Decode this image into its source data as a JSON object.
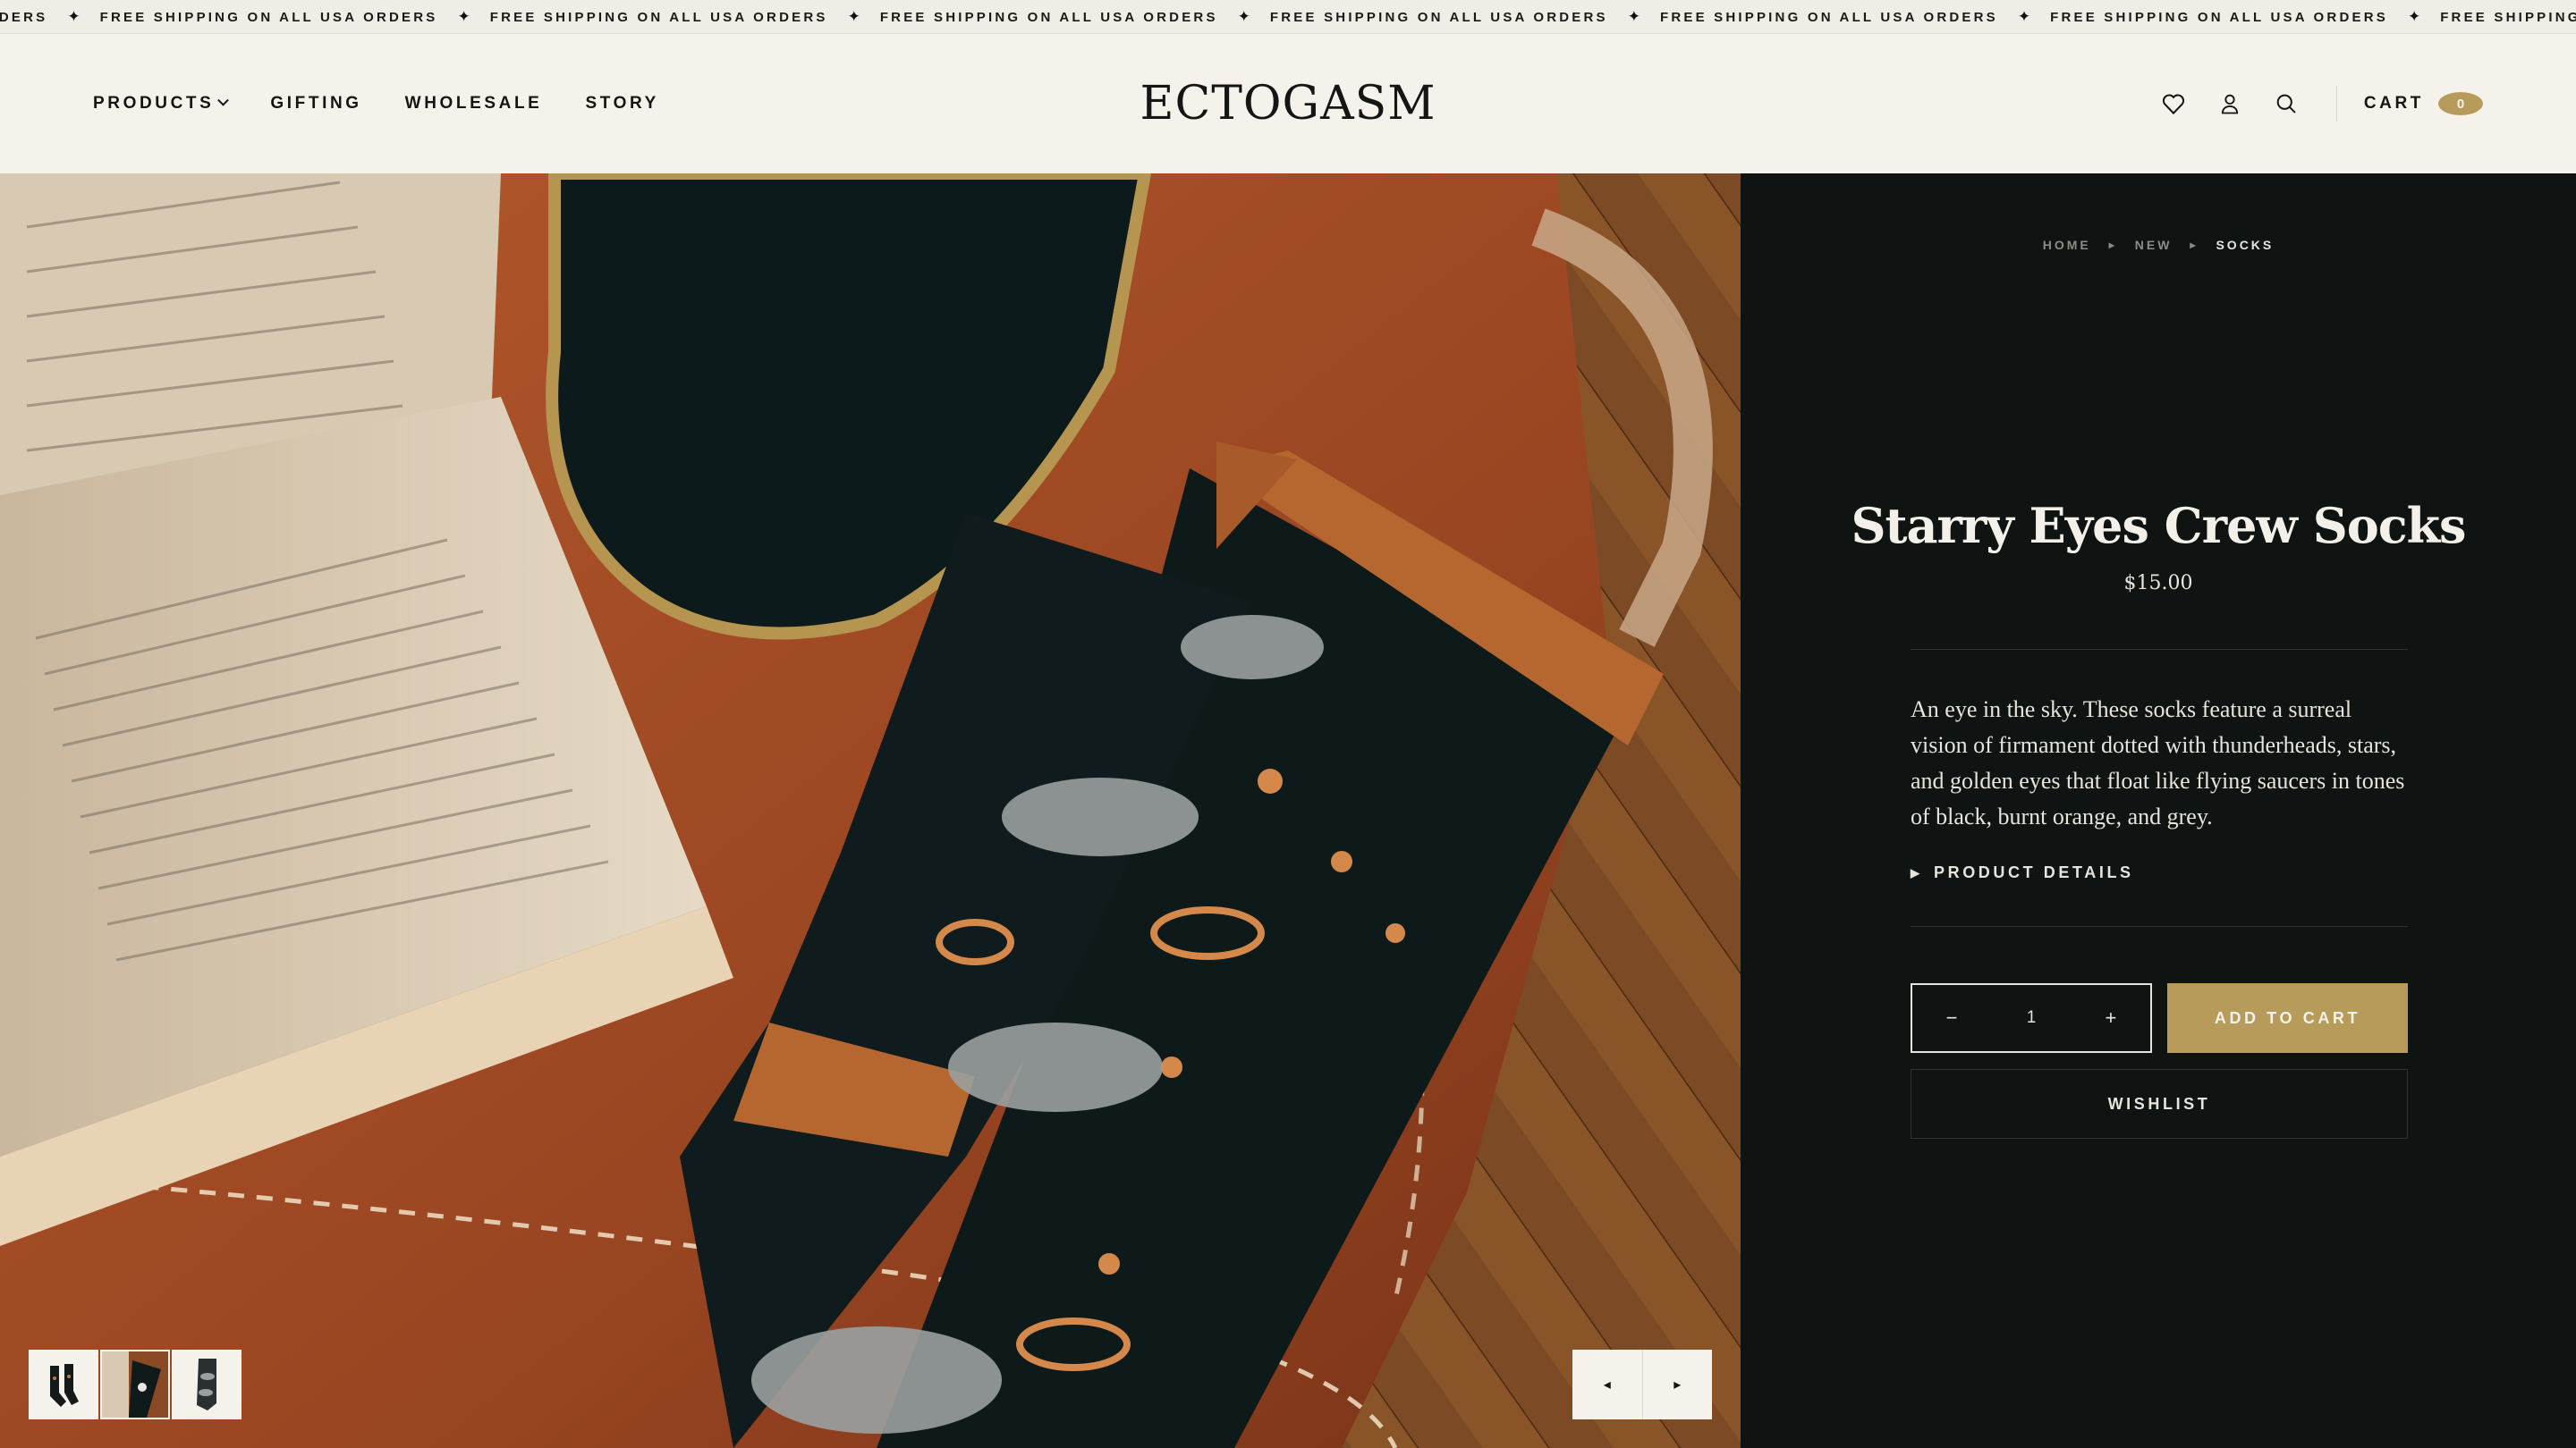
{
  "ticker": {
    "lead": "ORDERS",
    "message": "FREE SHIPPING ON ALL USA ORDERS",
    "tail": "FREE"
  },
  "nav": {
    "items": [
      {
        "label": "PRODUCTS"
      },
      {
        "label": "GIFTING"
      },
      {
        "label": "WHOLESALE"
      },
      {
        "label": "STORY"
      }
    ]
  },
  "logo": {
    "text": "ECTOGASM"
  },
  "header": {
    "cart_label": "CART",
    "cart_count": "0",
    "icons": [
      "heart-icon",
      "user-icon",
      "search-icon"
    ]
  },
  "gallery": {
    "thumbnail_count": 3,
    "prev_label": "◂",
    "next_label": "▸"
  },
  "breadcrumb": {
    "items": [
      "HOME",
      "NEW",
      "SOCKS"
    ],
    "separator": "▸"
  },
  "product": {
    "title": "Starry Eyes Crew Socks",
    "price": "$15.00",
    "description": "An eye in the sky. These socks feature a surreal vision of firmament dotted with thunderheads, stars, and golden eyes that float like flying saucers in tones of black, burnt orange, and grey.",
    "details_label": "PRODUCT DETAILS",
    "quantity": "1",
    "qty_minus": "−",
    "qty_plus": "+",
    "add_to_cart": "ADD TO CART",
    "wishlist": "WISHLIST"
  },
  "colors": {
    "accent_gold": "#b69b5b",
    "panel_bg": "#0f1412",
    "header_bg": "#f4f2ea"
  }
}
